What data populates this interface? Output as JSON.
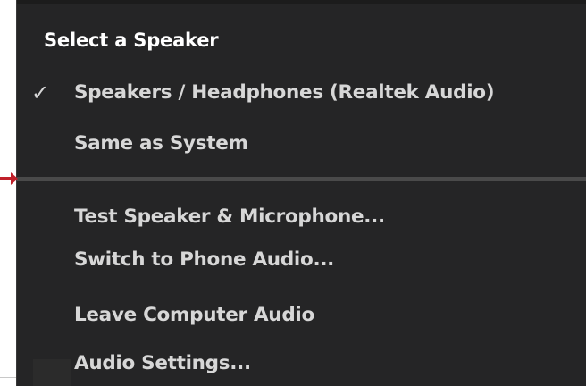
{
  "menu": {
    "section_header": "Select a Speaker",
    "speaker_options": [
      {
        "label": "Speakers / Headphones (Realtek Audio)",
        "selected": true
      },
      {
        "label": "Same as System",
        "selected": false
      }
    ],
    "check_glyph": "✓",
    "actions": [
      {
        "label": "Test Speaker & Microphone..."
      },
      {
        "label": "Switch to Phone Audio..."
      },
      {
        "label": "Leave Computer Audio"
      },
      {
        "label": "Audio Settings..."
      }
    ]
  },
  "colors": {
    "menu_background": "#252526",
    "text": "#d7d7d7",
    "header_text": "#ffffff",
    "divider": "#4a4a4a",
    "arrow_accent": "#c0202a"
  }
}
